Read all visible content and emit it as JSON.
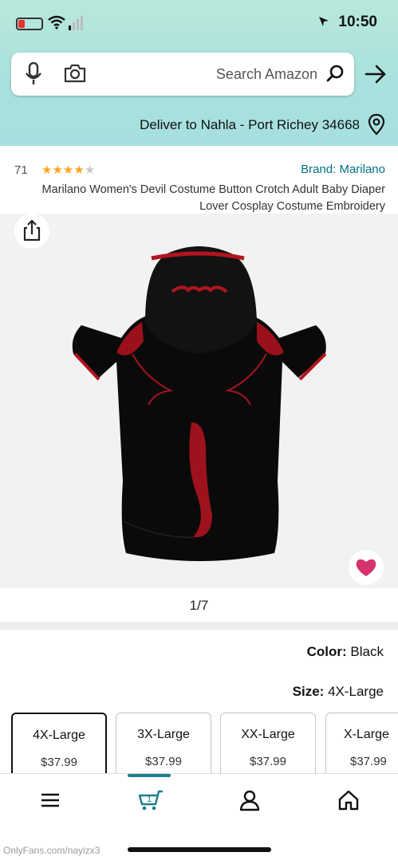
{
  "status_bar": {
    "time": "10:50"
  },
  "search": {
    "placeholder": "Search Amazon"
  },
  "delivery": {
    "text": "Deliver to Nahla - Port Richey 34668"
  },
  "product": {
    "brand": "Brand: Marilano",
    "rating_count": "71",
    "rating_stars": 4,
    "title": "Marilano Women's Devil Costume Button Crotch Adult Baby Diaper Lover Cosplay Costume Embroidery",
    "image_counter": "1/7",
    "color_label": "Color:",
    "color_value": "Black",
    "size_label": "Size:",
    "size_value": "4X-Large"
  },
  "sizes": [
    {
      "name": "4X-Large",
      "price": "$37.99",
      "selected": true
    },
    {
      "name": "3X-Large",
      "price": "$37.99",
      "selected": false
    },
    {
      "name": "XX-Large",
      "price": "$37.99",
      "selected": false
    },
    {
      "name": "X-Large",
      "price": "$37.99",
      "selected": false
    }
  ],
  "colors": {
    "link": "#007185",
    "star": "#ffa41c",
    "heart": "#d5336d",
    "accent": "#1b7f8c"
  },
  "watermark": "OnlyFans.com/nayizx3"
}
